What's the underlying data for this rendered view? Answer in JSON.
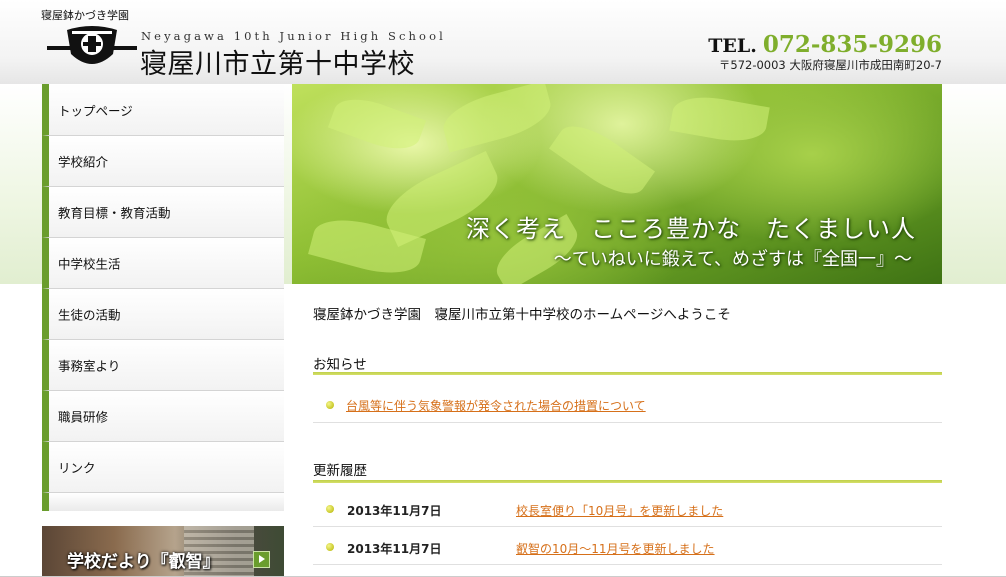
{
  "header": {
    "tagline": "寝屋鉢かづき学園",
    "school_en": "Neyagawa 10th Junior High School",
    "school_jp": "寝屋川市立第十中学校",
    "tel_label": "TEL.",
    "tel_number": "072-835-9296",
    "address": "〒572-0003 大阪府寝屋川市成田南町20-7",
    "logo_icon": "school-crest-icon"
  },
  "sidebar": {
    "items": [
      {
        "label": "トップページ"
      },
      {
        "label": "学校紹介"
      },
      {
        "label": "教育目標・教育活動"
      },
      {
        "label": "中学校生活"
      },
      {
        "label": "生徒の活動"
      },
      {
        "label": "事務室より"
      },
      {
        "label": "職員研修"
      },
      {
        "label": "リンク"
      }
    ],
    "banner_label": "学校だより『叡智』",
    "accent_color": "#6a9d2d"
  },
  "hero": {
    "line1": "深く考え　こころ豊かな　たくましい人",
    "line2": "～ていねいに鍛えて、めざすは『全国一』～"
  },
  "main": {
    "welcome": "寝屋鉢かづき学園　寝屋川市立第十中学校のホームページへようこそ",
    "notices_title": "お知らせ",
    "notices": [
      {
        "text": "台風等に伴う気象警報が発令された場合の措置について"
      }
    ],
    "history_title": "更新履歴",
    "history": [
      {
        "date": "2013年11月7日",
        "text": "校長室便り「10月号」を更新しました"
      },
      {
        "date": "2013年11月7日",
        "text": "叡智の10月～11月号を更新しました"
      }
    ],
    "link_color": "#d6701a"
  }
}
